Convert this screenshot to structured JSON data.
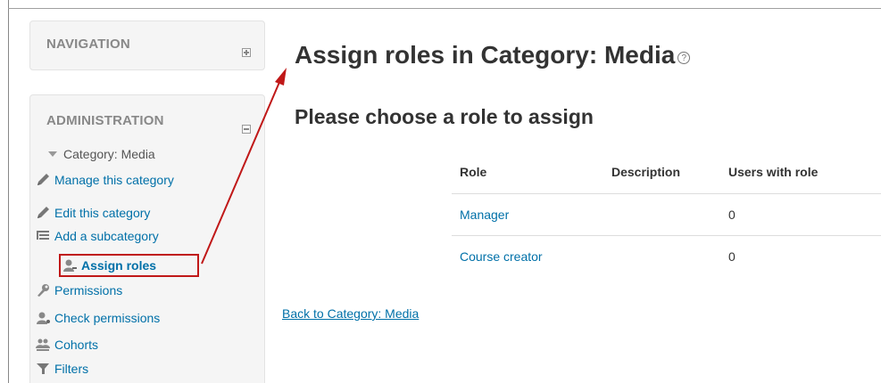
{
  "navigation": {
    "title": "NAVIGATION"
  },
  "administration": {
    "title": "ADMINISTRATION",
    "category": "Category: Media",
    "items": [
      {
        "label": "Manage this category",
        "icon": "pencil-icon"
      },
      {
        "label": "Edit this category",
        "icon": "pencil-icon"
      },
      {
        "label": "Add a subcategory",
        "icon": "list-icon"
      },
      {
        "label": "Assign roles",
        "icon": "assign-roles-icon"
      },
      {
        "label": "Permissions",
        "icon": "wrench-icon"
      },
      {
        "label": "Check permissions",
        "icon": "user-check-icon"
      },
      {
        "label": "Cohorts",
        "icon": "cohorts-icon"
      },
      {
        "label": "Filters",
        "icon": "filter-icon"
      }
    ]
  },
  "main": {
    "title": "Assign roles in Category: Media",
    "subtitle": "Please choose a role to assign",
    "table": {
      "headers": [
        "Role",
        "Description",
        "Users with role"
      ],
      "rows": [
        {
          "role": "Manager",
          "description": "",
          "users": "0"
        },
        {
          "role": "Course creator",
          "description": "",
          "users": "0"
        }
      ]
    },
    "back_link": "Back to Category: Media"
  },
  "colors": {
    "link": "#0070a8",
    "annotation": "#c01818",
    "block_bg": "#f5f5f5"
  }
}
